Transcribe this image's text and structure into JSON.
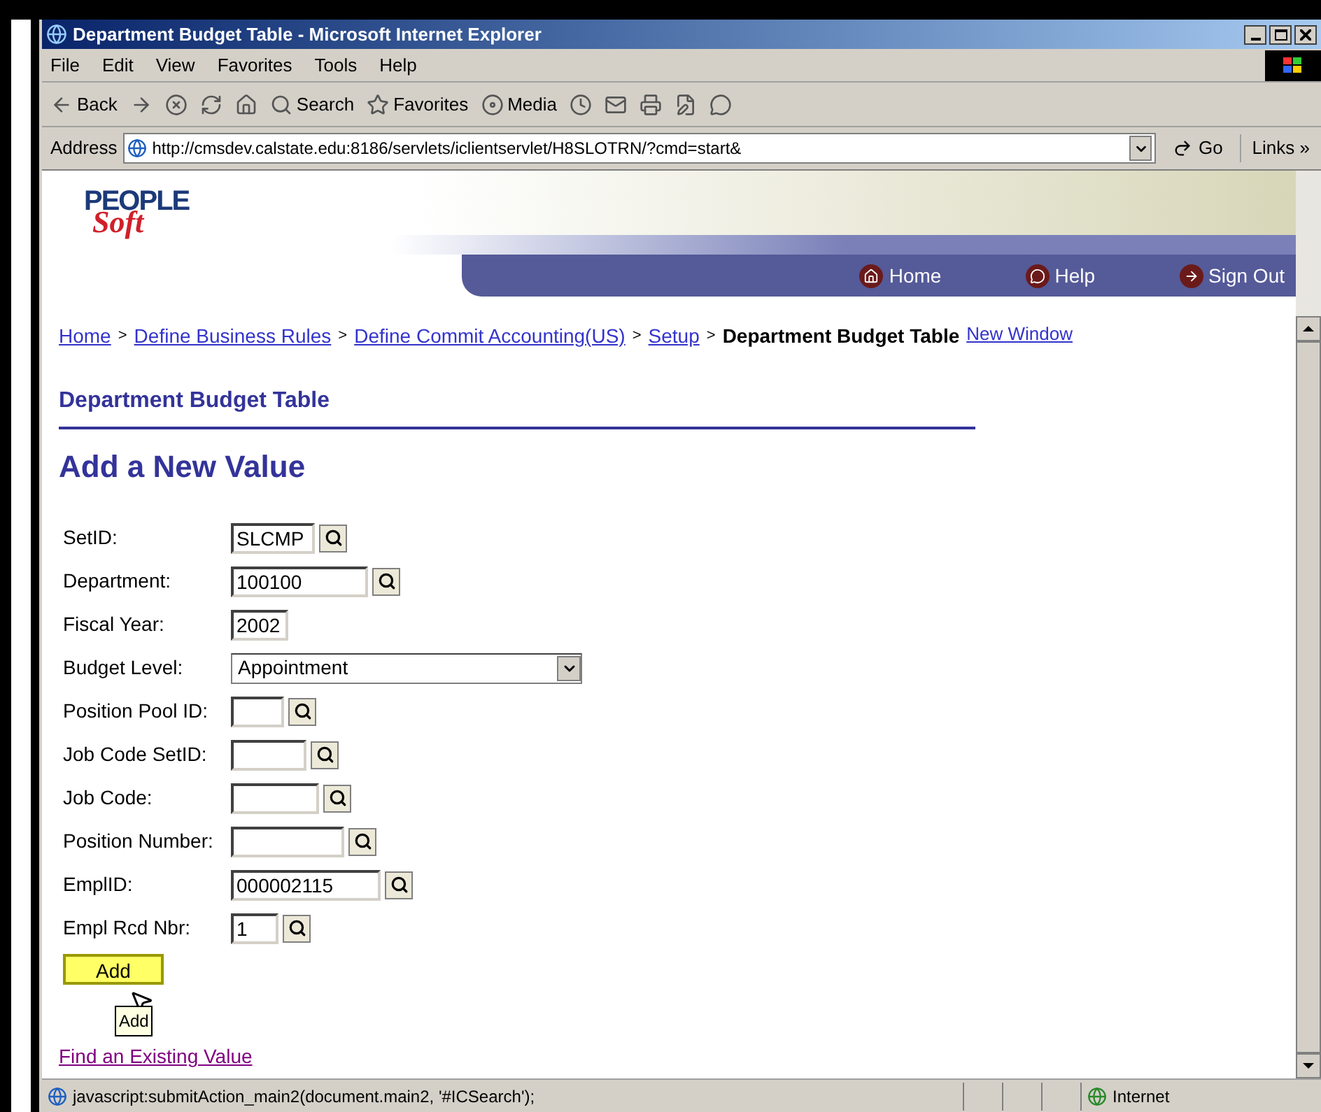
{
  "window": {
    "title": "Department Budget Table - Microsoft Internet Explorer"
  },
  "menu": [
    "File",
    "Edit",
    "View",
    "Favorites",
    "Tools",
    "Help"
  ],
  "toolbar": [
    {
      "kind": "back",
      "label": "Back"
    },
    {
      "kind": "forward"
    },
    {
      "kind": "stop"
    },
    {
      "kind": "refresh"
    },
    {
      "kind": "home"
    },
    {
      "kind": "search",
      "label": "Search"
    },
    {
      "kind": "favorites",
      "label": "Favorites"
    },
    {
      "kind": "media",
      "label": "Media"
    },
    {
      "kind": "history"
    },
    {
      "kind": "mail"
    },
    {
      "kind": "print"
    },
    {
      "kind": "edit"
    },
    {
      "kind": "discuss"
    }
  ],
  "address": {
    "label": "Address",
    "value": "http://cmsdev.calstate.edu:8186/servlets/iclientservlet/H8SLOTRN/?cmd=start&",
    "go": "Go",
    "links": "Links »"
  },
  "header": {
    "logo_top": "PEOPLE",
    "logo_bottom": "Soft",
    "nav": [
      {
        "kind": "home",
        "label": "Home"
      },
      {
        "kind": "help",
        "label": "Help"
      },
      {
        "kind": "signout",
        "label": "Sign Out"
      }
    ]
  },
  "breadcrumb": [
    {
      "label": "Home",
      "link": true
    },
    {
      "separator": ">",
      "label": "Define Business Rules",
      "link": true
    },
    {
      "separator": ">",
      "label": "Define Commit Accounting(US)",
      "link": true
    },
    {
      "separator": ">",
      "label": "Setup",
      "link": true
    },
    {
      "separator": ">",
      "label": "Department Budget Table",
      "link": false
    }
  ],
  "new_window": "New Window",
  "page_title": "Department Budget Table",
  "subtitle": "Add a New Value",
  "fields": [
    {
      "kind": "lookup",
      "label": "SetID:",
      "value": "SLCMP"
    },
    {
      "kind": "lookup",
      "label": "Department:",
      "value": "100100"
    },
    {
      "kind": "text",
      "label": "Fiscal Year:",
      "value": "2002"
    },
    {
      "kind": "select",
      "label": "Budget Level:",
      "value": "Appointment"
    },
    {
      "kind": "lookup",
      "label": "Position Pool ID:"
    },
    {
      "kind": "lookup",
      "label": "Job Code SetID:"
    },
    {
      "kind": "lookup",
      "label": "Job Code:"
    },
    {
      "kind": "lookup",
      "label": "Position Number:"
    },
    {
      "kind": "lookup",
      "label": "EmplID:",
      "value": "000002115"
    },
    {
      "kind": "lookup",
      "label": "Empl Rcd Nbr:",
      "value": "1"
    }
  ],
  "add_button": "Add",
  "tooltip": "Add",
  "find_link": "Find an Existing Value",
  "status_bar": {
    "text": "javascript:submitAction_main2(document.main2, '#ICSearch');",
    "zone": "Internet"
  }
}
